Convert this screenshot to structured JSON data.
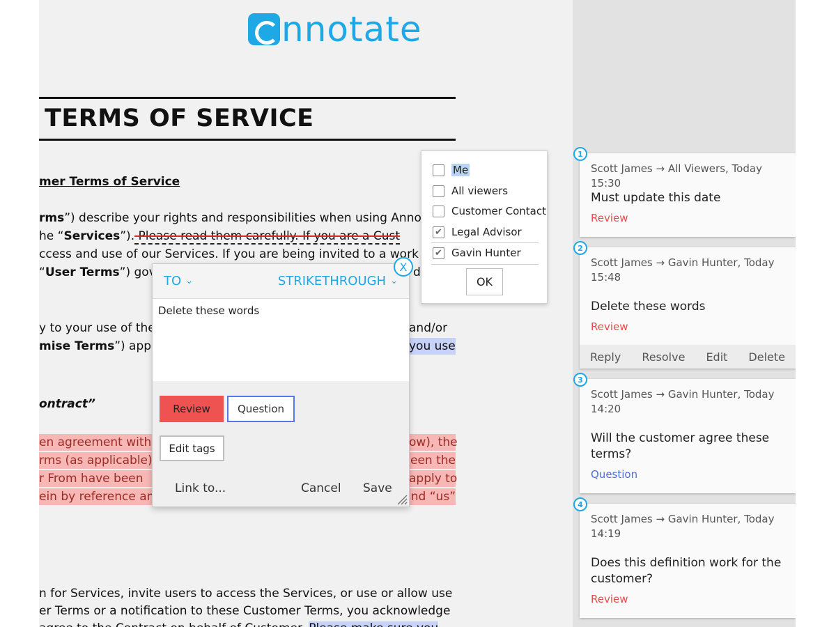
{
  "app": {
    "logo_text": "nnotate",
    "brand_color": "#1fa8e6"
  },
  "document": {
    "title": "TERMS OF SERVICE",
    "subheading": "mer Terms of Service",
    "para1": {
      "l1_a": "rms",
      "l1_b": "”) describe your rights and responsibilities when using Anno",
      "l2_a": "he “",
      "l2_b": "Services",
      "l2_c": "”).",
      "l2_strike": " Please read them carefully. If you are a Cust",
      "l3": "ccess and use of our Services. If you are being invited to a work",
      "l4_a": "“",
      "l4_b": "User Terms",
      "l4_c": "”) gove",
      "l4_d": "d"
    },
    "para2": {
      "l1_a": "y to your use of the",
      "l1_b": "and/or",
      "l2_a": "mise Terms",
      "l2_b": "”) apply",
      "l2_c": "you use"
    },
    "contract_heading": "ontract”",
    "para3": {
      "l1_a": "en agreement with",
      "l1_b": "ow), the",
      "l2_a": "rms (as applicable)",
      "l2_b": "een the",
      "l3_a": "r From have been",
      "l3_b": "apply to",
      "l4_a": "ein by reference an",
      "l4_b": "nd “us”"
    },
    "para4": {
      "l1": "n for Services, invite users to access the Services, or use or allow use",
      "l2": "er Terms or a notification to these Customer Terms, you acknowledge",
      "l3_a": " agree to the Contract on behalf of Customer.",
      "l3_b": "Please make sure you"
    }
  },
  "viewers_popup": {
    "items": [
      {
        "label": "Me",
        "checked": false
      },
      {
        "label": "All viewers",
        "checked": false
      },
      {
        "label": "Customer Contact",
        "checked": false
      },
      {
        "label": "Legal Advisor",
        "checked": true
      },
      {
        "label": "Gavin Hunter",
        "checked": true
      }
    ],
    "check_glyph": "✔",
    "ok_label": "OK"
  },
  "editor": {
    "to_label": "TO",
    "type_label": "STRIKETHROUGH",
    "chevron": "⌄",
    "close_glyph": "X",
    "text": "Delete these words",
    "review_label": "Review",
    "question_label": "Question",
    "edit_tags_label": "Edit tags",
    "link_label": "Link to...",
    "cancel_label": "Cancel",
    "save_label": "Save"
  },
  "comments": [
    {
      "num": "1",
      "meta": "Scott James → All Viewers, Today 15:30",
      "body": "Must update this date",
      "tag": "Review",
      "tag_color": "#e84a4a"
    },
    {
      "num": "2",
      "meta": "Scott James → Gavin Hunter, Today 15:48",
      "body": "Delete these words",
      "tag": "Review",
      "tag_color": "#e84a4a",
      "actions": {
        "reply": "Reply",
        "resolve": "Resolve",
        "edit": "Edit",
        "delete": "Delete"
      }
    },
    {
      "num": "3",
      "meta": "Scott James → Gavin Hunter, Today 14:20",
      "body": "Will the customer agree these terms?",
      "tag": "Question",
      "tag_color": "#4a6ee0"
    },
    {
      "num": "4",
      "meta": "Scott James → Gavin Hunter, Today 14:19",
      "body": "Does this definition work for the customer?",
      "tag": "Review",
      "tag_color": "#e84a4a"
    }
  ],
  "colors": {
    "review": "#ee5352",
    "question_border": "#5876e6",
    "highlight_red": "#f6b7b5",
    "highlight_blue": "#c6d2f7"
  }
}
